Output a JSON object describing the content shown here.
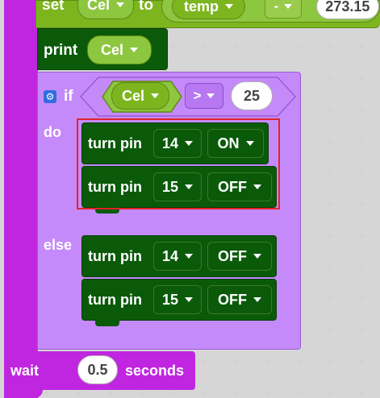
{
  "blocks": {
    "set": {
      "keyword": "set",
      "variable": "Cel",
      "to_label": "to",
      "source_var": "temp",
      "operator": "-",
      "value": "273.15"
    },
    "print": {
      "keyword": "print",
      "variable": "Cel"
    },
    "if": {
      "keyword": "if",
      "gear_icon": "gear-icon",
      "variable": "Cel",
      "comparator": ">",
      "value": "25",
      "do_label": "do",
      "else_label": "else"
    },
    "do_statements": [
      {
        "label": "turn pin",
        "pin": "14",
        "state": "ON"
      },
      {
        "label": "turn pin",
        "pin": "15",
        "state": "OFF"
      }
    ],
    "else_statements": [
      {
        "label": "turn pin",
        "pin": "14",
        "state": "OFF"
      },
      {
        "label": "turn pin",
        "pin": "15",
        "state": "OFF"
      }
    ],
    "wait": {
      "keyword": "wait",
      "value": "0.5",
      "unit": "seconds"
    }
  },
  "colors": {
    "outer_loop": "#c026e0",
    "if_block": "#c58af9",
    "variable_block": "#7db51f",
    "pin_block": "#0a5a0a",
    "highlight": "#e0242b"
  }
}
